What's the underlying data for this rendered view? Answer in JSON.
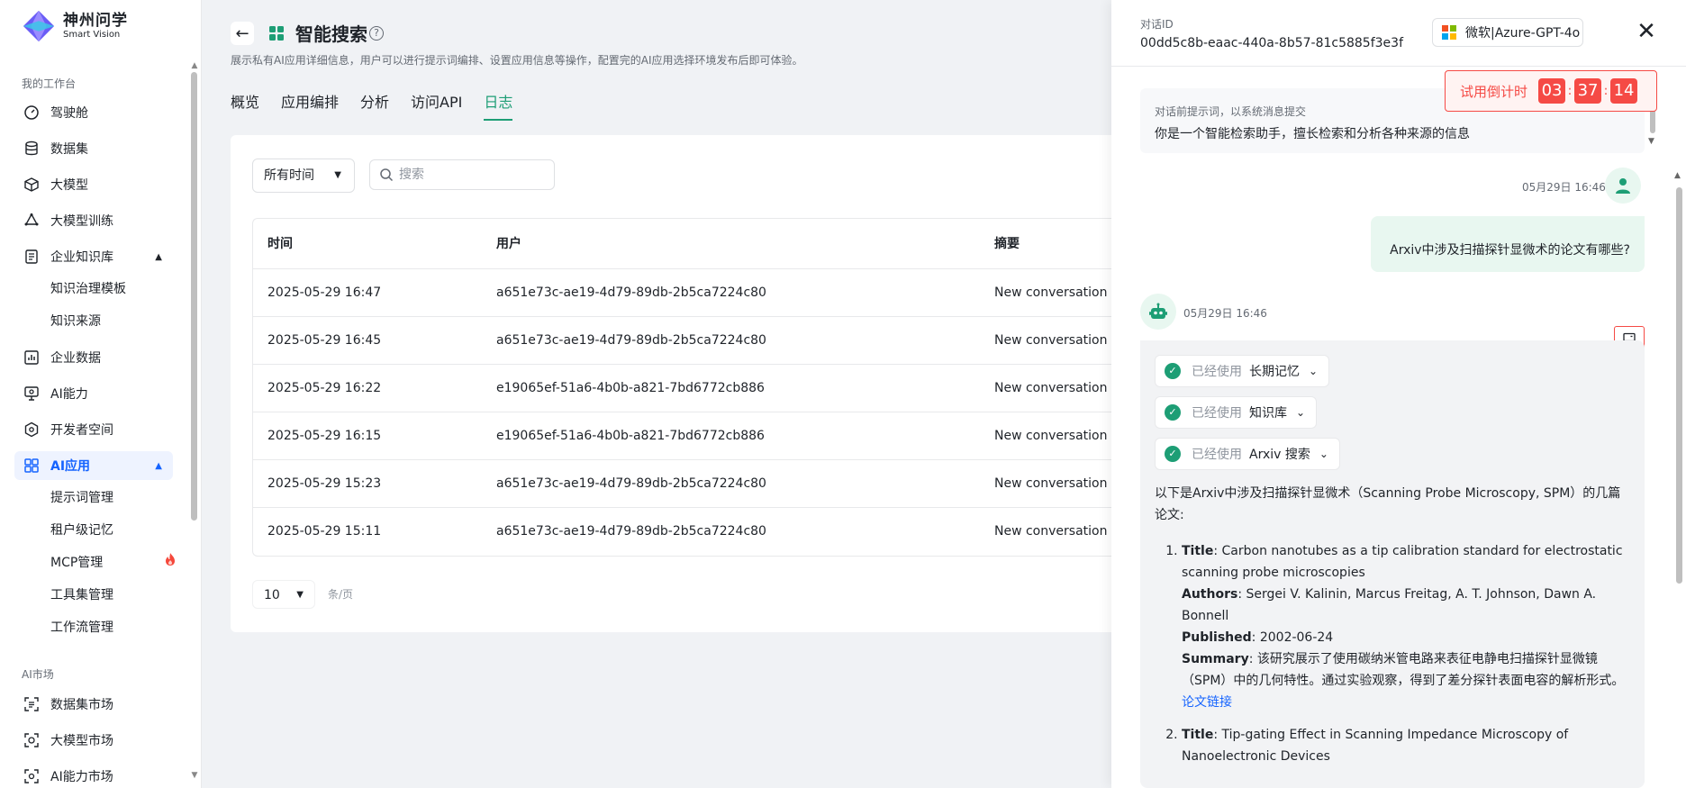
{
  "brand": {
    "name": "神州问学",
    "sub": "Smart Vision"
  },
  "sidebar": {
    "section_workspace": "我的工作台",
    "items": [
      {
        "label": "驾驶舱",
        "icon": "dashboard-icon"
      },
      {
        "label": "数据集",
        "icon": "database-icon"
      },
      {
        "label": "大模型",
        "icon": "cube-icon"
      },
      {
        "label": "大模型训练",
        "icon": "training-icon"
      },
      {
        "label": "企业知识库",
        "icon": "knowledge-icon",
        "expanded": true
      },
      {
        "label": "企业数据",
        "icon": "chart-icon"
      },
      {
        "label": "AI能力",
        "icon": "ai-capability-icon"
      },
      {
        "label": "开发者空间",
        "icon": "developer-icon"
      },
      {
        "label": "AI应用",
        "icon": "apps-icon",
        "active": true
      }
    ],
    "knowledge_sub": [
      "知识治理模板",
      "知识来源"
    ],
    "apps_sub": [
      "提示词管理",
      "租户级记忆",
      "MCP管理",
      "工具集管理",
      "工作流管理"
    ],
    "section_market": "AI市场",
    "market_items": [
      "数据集市场",
      "大模型市场",
      "AI能力市场"
    ]
  },
  "header": {
    "title": "智能搜索",
    "description": "展示私有AI应用详细信息，用户可以进行提示词编排、设置应用信息等操作，配置完的AI应用选择环境发布后即可体验。",
    "tabs": [
      "概览",
      "应用编排",
      "分析",
      "访问API",
      "日志"
    ],
    "active_tab": "日志"
  },
  "filters": {
    "time_select": "所有时间",
    "search_placeholder": "搜索"
  },
  "table": {
    "columns": [
      "时间",
      "用户",
      "摘要"
    ],
    "rows": [
      [
        "2025-05-29 16:47",
        "a651e73c-ae19-4d79-89db-2b5ca7224c80",
        "New conversation"
      ],
      [
        "2025-05-29 16:45",
        "a651e73c-ae19-4d79-89db-2b5ca7224c80",
        "New conversation"
      ],
      [
        "2025-05-29 16:22",
        "e19065ef-51a6-4b0b-a821-7bd6772cb886",
        "New conversation"
      ],
      [
        "2025-05-29 16:15",
        "e19065ef-51a6-4b0b-a821-7bd6772cb886",
        "New conversation"
      ],
      [
        "2025-05-29 15:23",
        "a651e73c-ae19-4d79-89db-2b5ca7224c80",
        "New conversation"
      ],
      [
        "2025-05-29 15:11",
        "a651e73c-ae19-4d79-89db-2b5ca7224c80",
        "New conversation"
      ]
    ]
  },
  "pager": {
    "page_size": "10",
    "unit": "条/页"
  },
  "drawer": {
    "conv_label": "对话ID",
    "conv_id": "00dd5c8b-eaac-440a-8b57-81c5885f3e3f",
    "model": "微软|Azure-GPT-4o",
    "countdown": {
      "label": "试用倒计时",
      "h": "03",
      "m": "37",
      "s": "14"
    },
    "system_prompt_label": "对话前提示词，以系统消息提交",
    "system_prompt": "你是一个智能检索助手，擅长检索和分析各种来源的信息",
    "user_time": "05月29日 16:46",
    "user_message": "Arxiv中涉及扫描探针显微术的论文有哪些?",
    "bot_time": "05月29日 16:46",
    "tools": [
      {
        "used": "已经使用",
        "name": "长期记忆"
      },
      {
        "used": "已经使用",
        "name": "知识库"
      },
      {
        "used": "已经使用",
        "name": "Arxiv 搜索"
      }
    ],
    "answer_intro": "以下是Arxiv中涉及扫描探针显微术（Scanning Probe Microscopy, SPM）的几篇论文:",
    "labels": {
      "title": "Title",
      "authors": "Authors",
      "published": "Published",
      "summary": "Summary"
    },
    "papers": [
      {
        "title": "Carbon nanotubes as a tip calibration standard for electrostatic scanning probe microscopies",
        "authors": "Sergei V. Kalinin, Marcus Freitag, A. T. Johnson, Dawn A. Bonnell",
        "published": "2002-06-24",
        "summary": "该研究展示了使用碳纳米管电路来表征电静电扫描探针显微镜（SPM）中的几何特性。通过实验观察，得到了差分探针表面电容的解析形式。",
        "link": "论文链接"
      },
      {
        "title": "Tip-gating Effect in Scanning Impedance Microscopy of Nanoelectronic Devices"
      }
    ]
  },
  "colors": {
    "accent_green": "#1d9e75",
    "active_blue": "#1664ff",
    "alert_red": "#f54a45"
  }
}
